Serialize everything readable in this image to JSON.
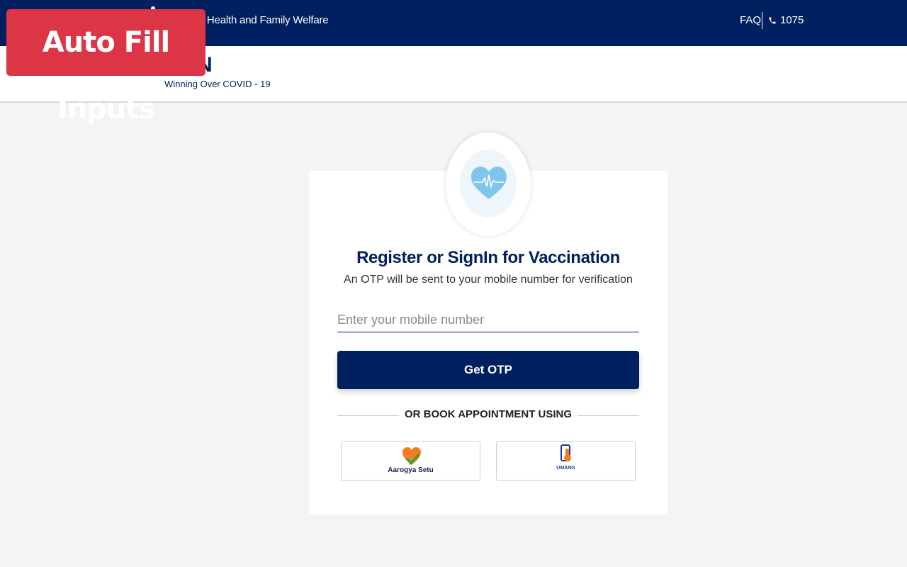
{
  "topbar": {
    "ministry": "f Health and Family Welfare",
    "faq": "FAQ",
    "helpline": "1075"
  },
  "header": {
    "logo_fragment": "N",
    "tagline": "Winning Over COVID - 19"
  },
  "overlay_badge": "Auto Fill Inputs",
  "login": {
    "title": "Register or SignIn for Vaccination",
    "subtitle": "An OTP will be sent to your mobile number for verification",
    "mobile_placeholder": "Enter your mobile number",
    "mobile_value": "",
    "get_otp_label": "Get OTP",
    "divider_text": "OR BOOK APPOINTMENT USING"
  },
  "apps": [
    {
      "label": "Aarogya Setu",
      "icon": "aarogya-heart-icon"
    },
    {
      "label": "UMANG",
      "icon": "umang-phone-icon"
    }
  ],
  "colors": {
    "navy": "#002060",
    "badge_red": "#dc3545",
    "aarogya_orange": "#f47b20",
    "aarogya_green": "#22a640"
  }
}
